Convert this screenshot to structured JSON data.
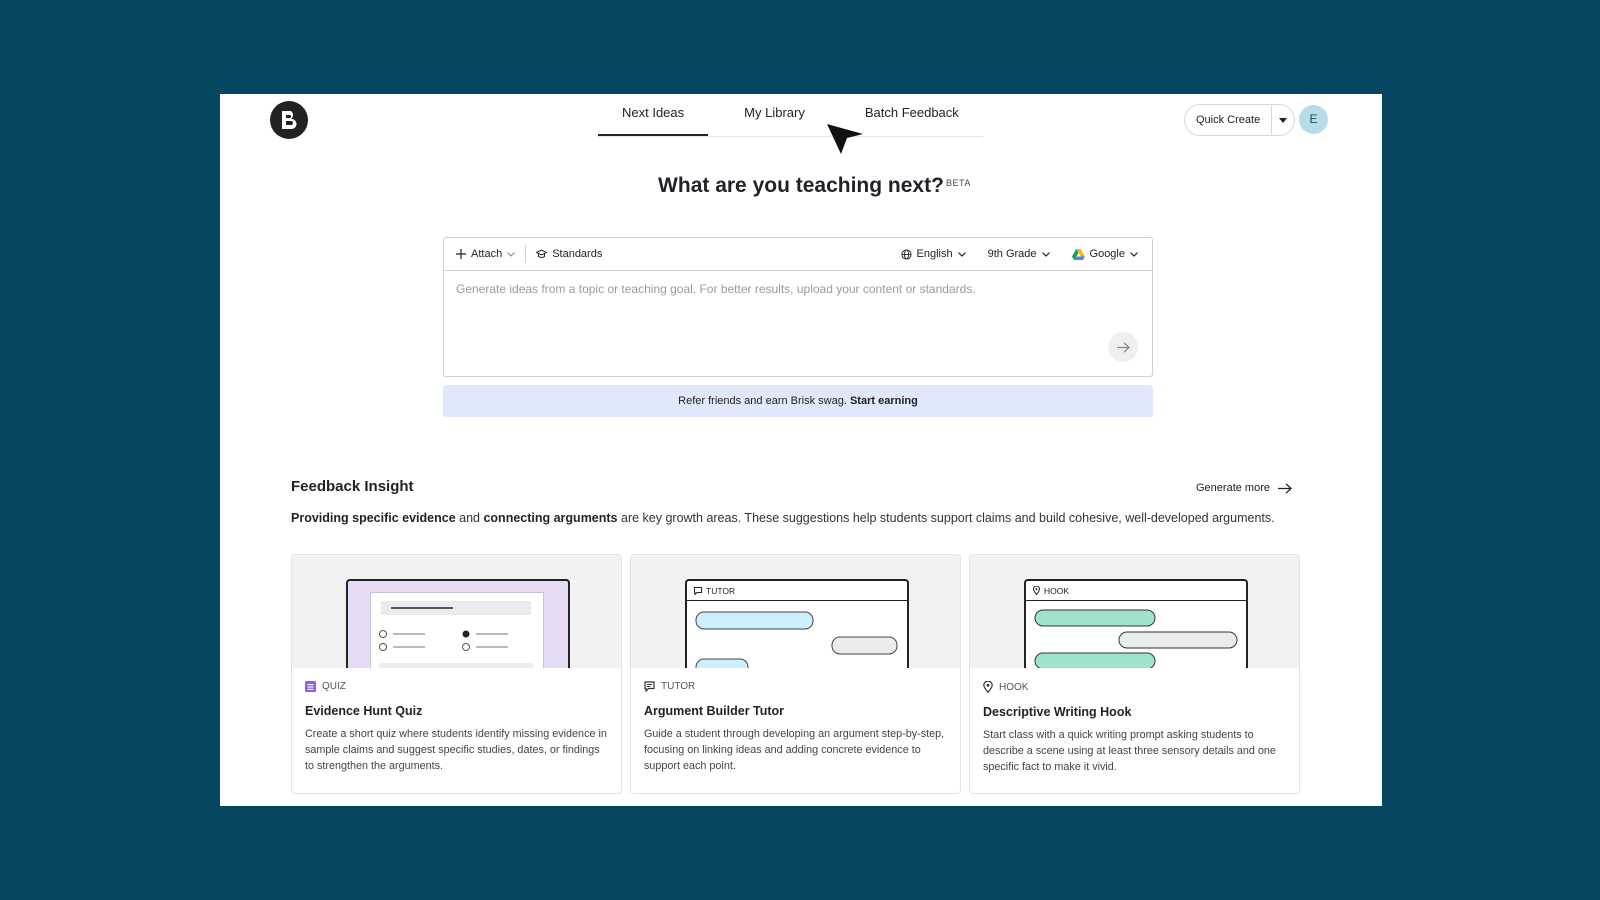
{
  "nav": {
    "tabs": [
      {
        "label": "Next Ideas"
      },
      {
        "label": "My Library"
      },
      {
        "label": "Batch Feedback"
      }
    ],
    "quick_create": "Quick Create",
    "avatar_initial": "E"
  },
  "hero": {
    "title": "What are you teaching next?",
    "badge": "BETA"
  },
  "prompt": {
    "attach": "Attach",
    "standards": "Standards",
    "language": "English",
    "grade": "9th Grade",
    "provider": "Google",
    "placeholder": "Generate ideas from a topic or teaching goal. For better results, upload your content or standards."
  },
  "refer": {
    "text": "Refer friends and earn Brisk swag.",
    "link": "Start earning"
  },
  "insight": {
    "title": "Feedback Insight",
    "generate_more": "Generate more",
    "bold1": "Providing specific evidence",
    "mid": " and ",
    "bold2": "connecting arguments",
    "rest": " are key growth areas. These suggestions help students support claims and build cohesive, well-developed arguments."
  },
  "cards": [
    {
      "tag": "QUIZ",
      "title": "Evidence Hunt Quiz",
      "desc": "Create a short quiz where students identify missing evidence in sample claims and suggest specific studies, dates, or findings to strengthen the arguments."
    },
    {
      "tag": "TUTOR",
      "preview_tag": "TUTOR",
      "title": "Argument Builder Tutor",
      "desc": "Guide a student through developing an argument step-by-step, focusing on linking ideas and adding concrete evidence to support each point."
    },
    {
      "tag": "HOOK",
      "preview_tag": "HOOK",
      "title": "Descriptive Writing Hook",
      "desc": "Start class with a quick writing prompt asking students to describe a scene using at least three sensory details and one specific fact to make it vivid."
    }
  ],
  "colors": {
    "background": "#074660",
    "refer_banner": "#dfe9fb",
    "quiz_accent": "#8b5cf6",
    "tutor_bubble": "#cdeefb",
    "hook_bubble": "#9fe3cf"
  }
}
